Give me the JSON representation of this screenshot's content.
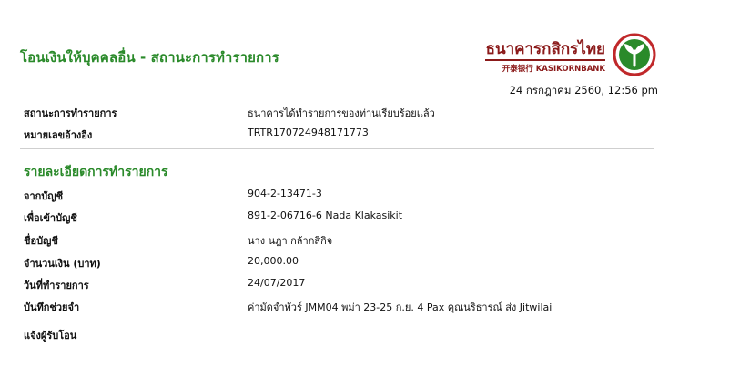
{
  "header": {
    "title": "โอนเงินให้บุคคลอื่น - สถานะการทำรายการ"
  },
  "logo": {
    "thai_name": "ธนาคารกสิกรไทย",
    "english_name": "开泰银行 KASIKORNBANK",
    "colors": {
      "brand_green": "#2a8a2a",
      "brand_red": "#c0282a"
    }
  },
  "transaction_datetime": "24 กรกฎาคม 2560, 12:56 pm",
  "status": [
    {
      "label": "สถานะการทำรายการ",
      "value": "ธนาคารได้ทำรายการของท่านเรียบร้อยแล้ว"
    },
    {
      "label": "หมายเลขอ้างอิง",
      "value": "TRTR170724948171773"
    }
  ],
  "details": {
    "title": "รายละเอียดการทำรายการ",
    "rows": [
      {
        "label": "จากบัญชี",
        "value": "904-2-13471-3"
      },
      {
        "label": "เพื่อเข้าบัญชี",
        "value": "891-2-06716-6 Nada Klakasikit"
      },
      {
        "label": "ชื่อบัญชี",
        "value": "นาง นฎา กล้ากสิกิจ"
      },
      {
        "label": "จำนวนเงิน (บาท)",
        "value": "20,000.00"
      },
      {
        "label": "วันที่ทำรายการ",
        "value": "24/07/2017"
      },
      {
        "label": "บันทึกช่วยจำ",
        "value": "ค่ามัดจำทัวร์ JMM04 พม่า 23-25 ก.ย. 4 Pax คุณนริธารณ์ ส่ง Jitwilai"
      },
      {
        "label": "แจ้งผู้รับโอน",
        "value": ""
      }
    ]
  }
}
